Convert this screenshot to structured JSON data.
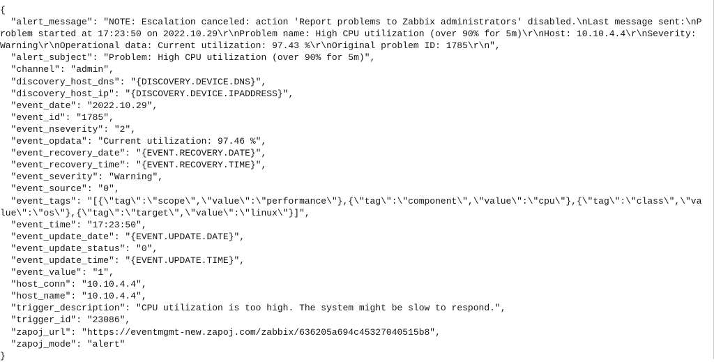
{
  "viewer": {
    "name": "json-payload-viewer",
    "format": "json",
    "indent": "  "
  },
  "payload": {
    "alert_message": "NOTE: Escalation canceled: action 'Report problems to Zabbix administrators' disabled.\\nLast message sent:\\nProblem started at 17:23:50 on 2022.10.29\\r\\nProblem name: High CPU utilization (over 90% for 5m)\\r\\nHost: 10.10.4.4\\r\\nSeverity: Warning\\r\\nOperational data: Current utilization: 97.43 %\\r\\nOriginal problem ID: 1785\\r\\n",
    "alert_subject": "Problem: High CPU utilization (over 90% for 5m)",
    "channel": "admin",
    "discovery_host_dns": "{DISCOVERY.DEVICE.DNS}",
    "discovery_host_ip": "{DISCOVERY.DEVICE.IPADDRESS}",
    "event_date": "2022.10.29",
    "event_id": "1785",
    "event_nseverity": "2",
    "event_opdata": "Current utilization: 97.46 %",
    "event_recovery_date": "{EVENT.RECOVERY.DATE}",
    "event_recovery_time": "{EVENT.RECOVERY.TIME}",
    "event_severity": "Warning",
    "event_source": "0",
    "event_tags": "[{\\\"tag\\\":\\\"scope\\\",\\\"value\\\":\\\"performance\\\"},{\\\"tag\\\":\\\"component\\\",\\\"value\\\":\\\"cpu\\\"},{\\\"tag\\\":\\\"class\\\",\\\"value\\\":\\\"os\\\"},{\\\"tag\\\":\\\"target\\\",\\\"value\\\":\\\"linux\\\"}]",
    "event_time": "17:23:50",
    "event_update_date": "{EVENT.UPDATE.DATE}",
    "event_update_status": "0",
    "event_update_time": "{EVENT.UPDATE.TIME}",
    "event_value": "1",
    "host_conn": "10.10.4.4",
    "host_name": "10.10.4.4",
    "trigger_description": "CPU utilization is too high. The system might be slow to respond.",
    "trigger_id": "23086",
    "zapoj_url": "https://eventmgmt-new.zapoj.com/zabbix/636205a694c45327040515b8",
    "zapoj_mode": "alert"
  },
  "lines": [
    "{",
    "  \"alert_message\": \"NOTE: Escalation canceled: action 'Report problems to Zabbix administrators' disabled.\\nLast message sent:\\nProblem started at 17:23:50 on 2022.10.29\\r\\nProblem name: High CPU utilization (over 90% for 5m)\\r\\nHost: 10.10.4.4\\r\\nSeverity: Warning\\r\\nOperational data: Current utilization: 97.43 %\\r\\nOriginal problem ID: 1785\\r\\n\",",
    "  \"alert_subject\": \"Problem: High CPU utilization (over 90% for 5m)\",",
    "  \"channel\": \"admin\",",
    "  \"discovery_host_dns\": \"{DISCOVERY.DEVICE.DNS}\",",
    "  \"discovery_host_ip\": \"{DISCOVERY.DEVICE.IPADDRESS}\",",
    "  \"event_date\": \"2022.10.29\",",
    "  \"event_id\": \"1785\",",
    "  \"event_nseverity\": \"2\",",
    "  \"event_opdata\": \"Current utilization: 97.46 %\",",
    "  \"event_recovery_date\": \"{EVENT.RECOVERY.DATE}\",",
    "  \"event_recovery_time\": \"{EVENT.RECOVERY.TIME}\",",
    "  \"event_severity\": \"Warning\",",
    "  \"event_source\": \"0\",",
    "  \"event_tags\": \"[{\\\"tag\\\":\\\"scope\\\",\\\"value\\\":\\\"performance\\\"},{\\\"tag\\\":\\\"component\\\",\\\"value\\\":\\\"cpu\\\"},{\\\"tag\\\":\\\"class\\\",\\\"value\\\":\\\"os\\\"},{\\\"tag\\\":\\\"target\\\",\\\"value\\\":\\\"linux\\\"}]\",",
    "  \"event_time\": \"17:23:50\",",
    "  \"event_update_date\": \"{EVENT.UPDATE.DATE}\",",
    "  \"event_update_status\": \"0\",",
    "  \"event_update_time\": \"{EVENT.UPDATE.TIME}\",",
    "  \"event_value\": \"1\",",
    "  \"host_conn\": \"10.10.4.4\",",
    "  \"host_name\": \"10.10.4.4\",",
    "  \"trigger_description\": \"CPU utilization is too high. The system might be slow to respond.\",",
    "  \"trigger_id\": \"23086\",",
    "  \"zapoj_url\": \"https://eventmgmt-new.zapoj.com/zabbix/636205a694c45327040515b8\",",
    "  \"zapoj_mode\": \"alert\"",
    "}"
  ]
}
